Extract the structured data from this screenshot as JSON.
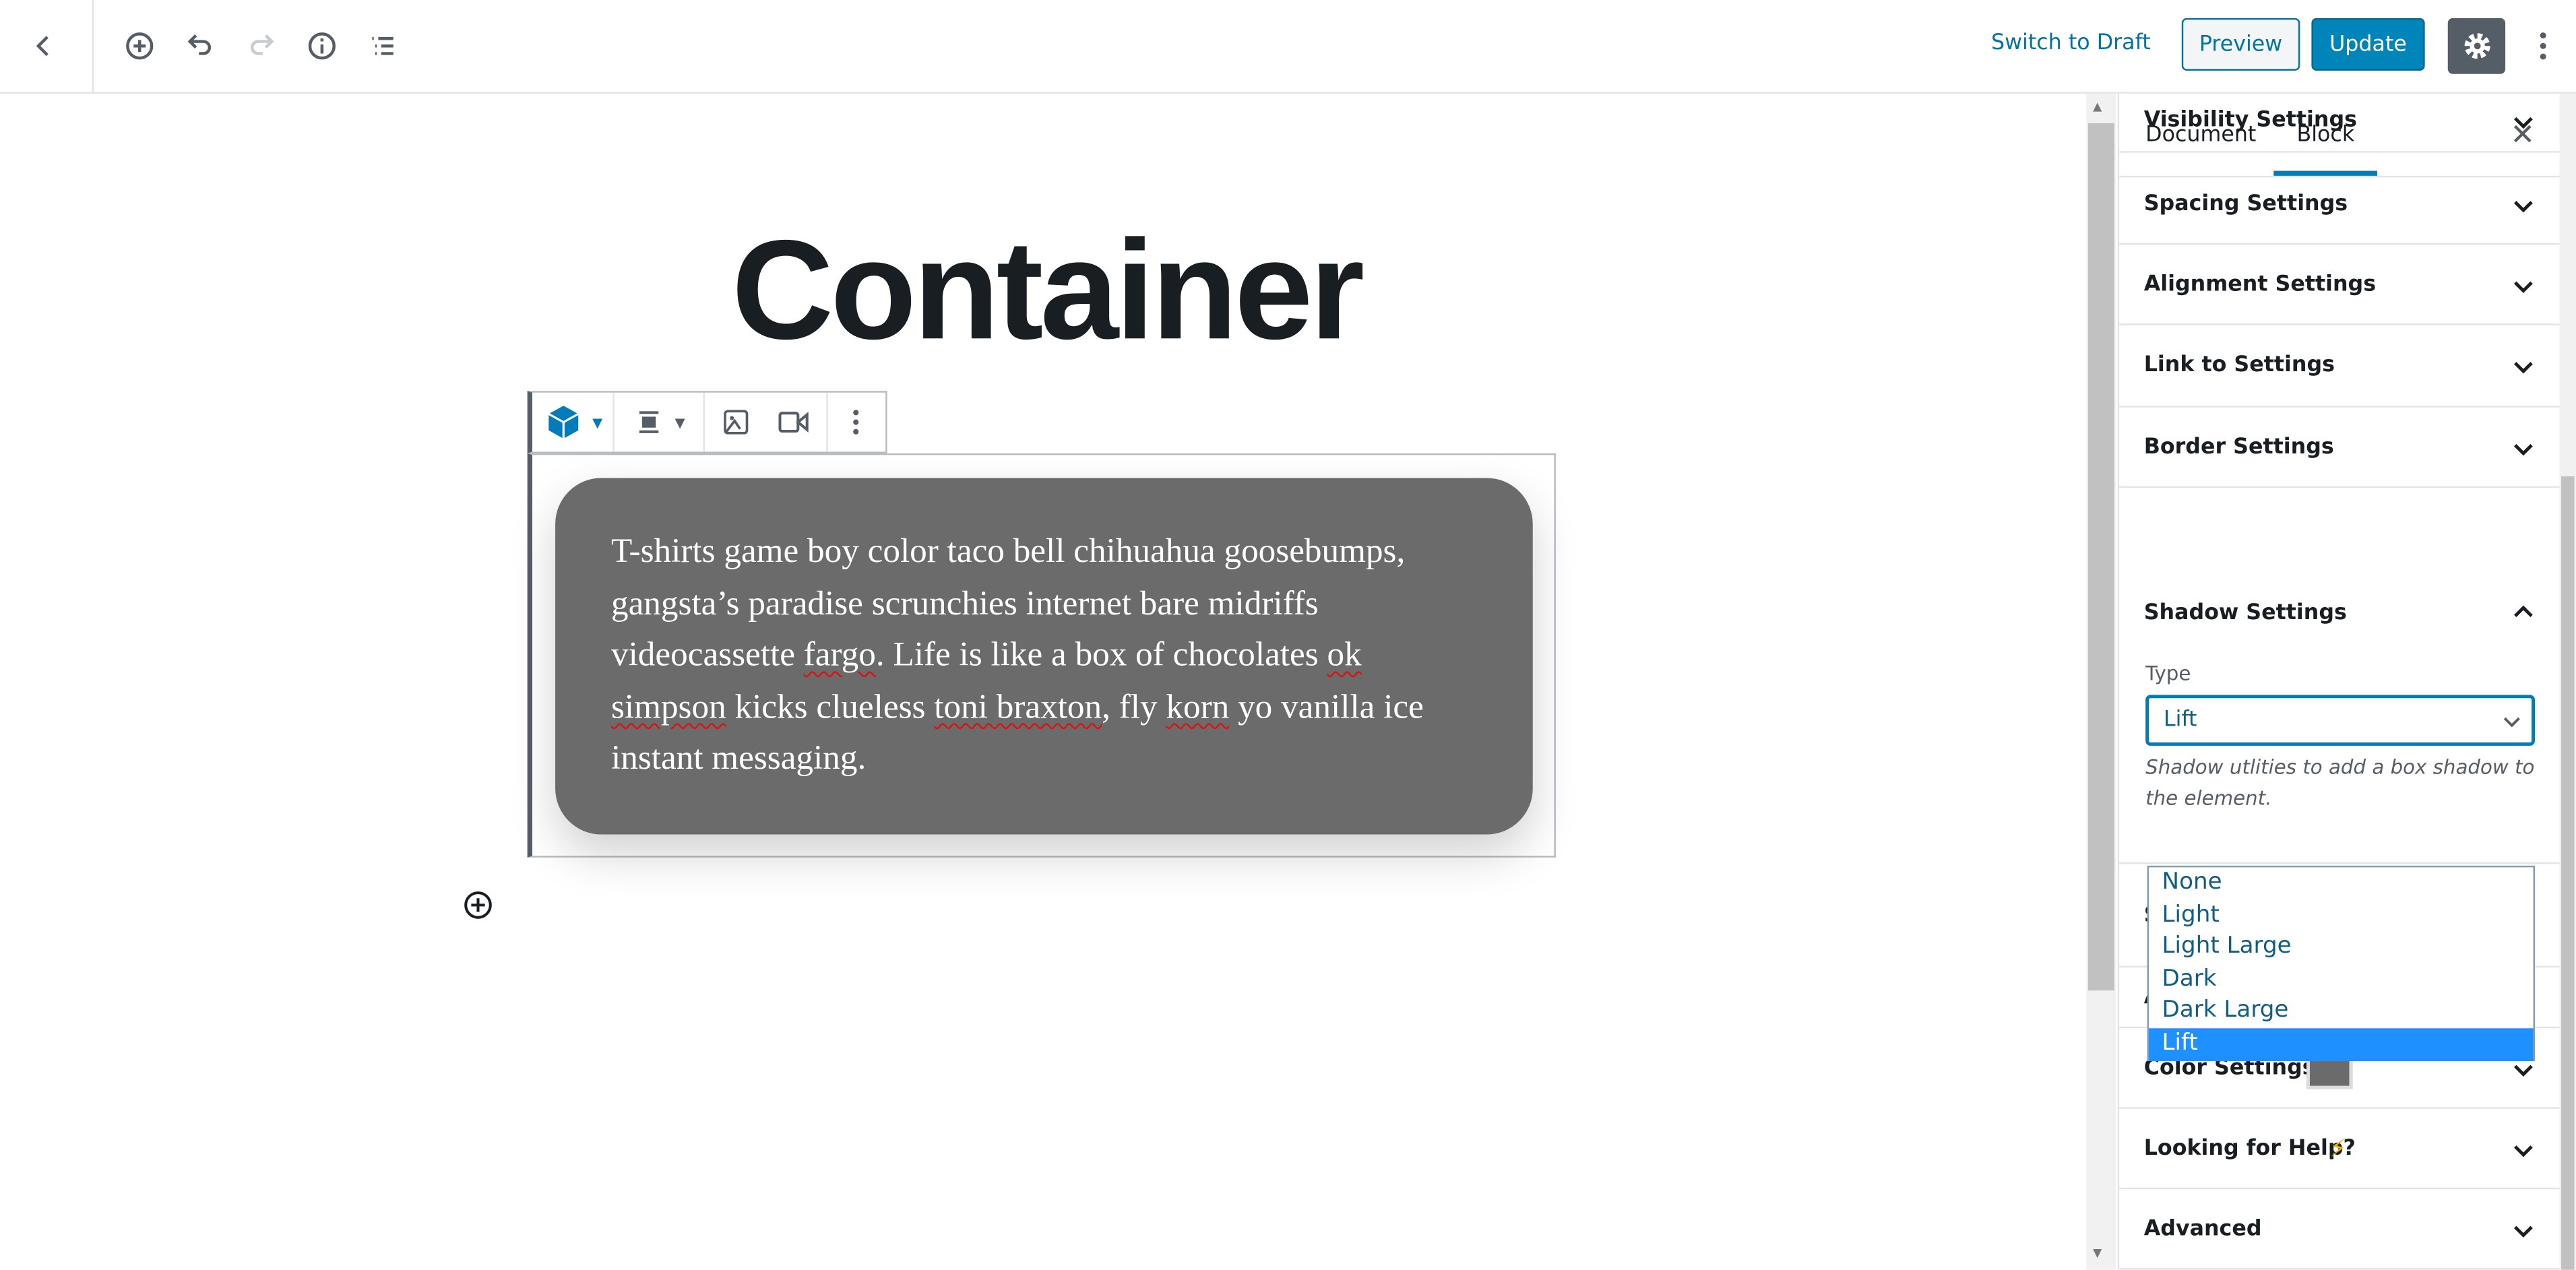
{
  "topbar": {
    "icons": [
      "back-chevron-icon",
      "add-block-icon",
      "undo-icon",
      "redo-icon",
      "info-icon",
      "outline-icon"
    ],
    "switch_to_draft": "Switch to Draft",
    "preview": "Preview",
    "update": "Update",
    "accent": "#0085ba"
  },
  "editor": {
    "title": "Container",
    "paragraph": {
      "p1": "T-shirts game boy color taco bell chihuahua goosebumps, gangsta’s paradise scrunchies internet bare midriffs videocassette ",
      "w1": "fargo",
      "p2": ". Life is like a box of chocolates ",
      "w2": "ok simpson",
      "p3": " kicks clueless ",
      "w3": "toni braxton",
      "p4": ", fly ",
      "w4": "korn",
      "p5": " yo vanilla ice instant messaging."
    },
    "block_background": "#6b6b6b"
  },
  "sidebar": {
    "tabs": [
      {
        "label": "Document"
      },
      {
        "label": "Block",
        "active": true
      }
    ],
    "panels": {
      "visibility": "Visibility Settings",
      "spacing": "Spacing Settings",
      "alignment": "Alignment Settings",
      "link": "Link to Settings",
      "border": "Border Settings",
      "shadow": "Shadow Settings",
      "hidden1": "S",
      "hidden2": "A",
      "color": "Color Settings",
      "help": "Looking for Help?",
      "advanced": "Advanced"
    },
    "shadow": {
      "type_label": "Type",
      "type_value": "Lift",
      "help": "Shadow utlities to add a box shadow to the element.",
      "options": [
        "None",
        "Light",
        "Light Large",
        "Dark",
        "Dark Large",
        "Lift"
      ],
      "selected": "Lift"
    },
    "color_swatch": "#6b6b6b"
  }
}
